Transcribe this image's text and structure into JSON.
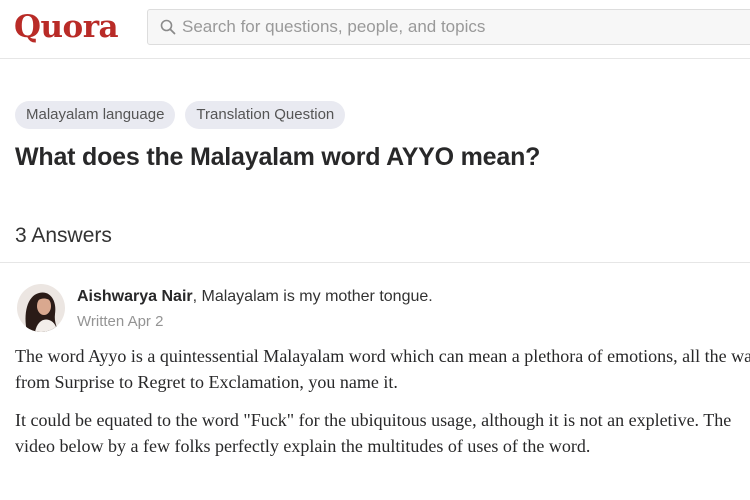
{
  "header": {
    "logo": "Quora",
    "search_placeholder": "Search for questions, people, and topics",
    "search_icon": "search-icon"
  },
  "question": {
    "topics": [
      "Malayalam language",
      "Translation Question"
    ],
    "title": "What does the Malayalam word AYYO mean?",
    "answer_count": "3 Answers"
  },
  "answer": {
    "author_name": "Aishwarya Nair",
    "author_credential": ", Malayalam is my mother tongue.",
    "written": "Written Apr 2",
    "paragraphs": [
      "The word Ayyo is a quintessential Malayalam word which can mean a plethora of emotions, all the way from Surprise to Regret to Exclamation, you name it.",
      "It could be equated to the word \"Fuck\" for the ubiquitous usage, although it is not an expletive. The video below by a few folks perfectly explain the multitudes  of uses of the word."
    ]
  },
  "colors": {
    "brand": "#b92b27",
    "topic_bg": "#e9eaf1",
    "muted_text": "#949494"
  }
}
